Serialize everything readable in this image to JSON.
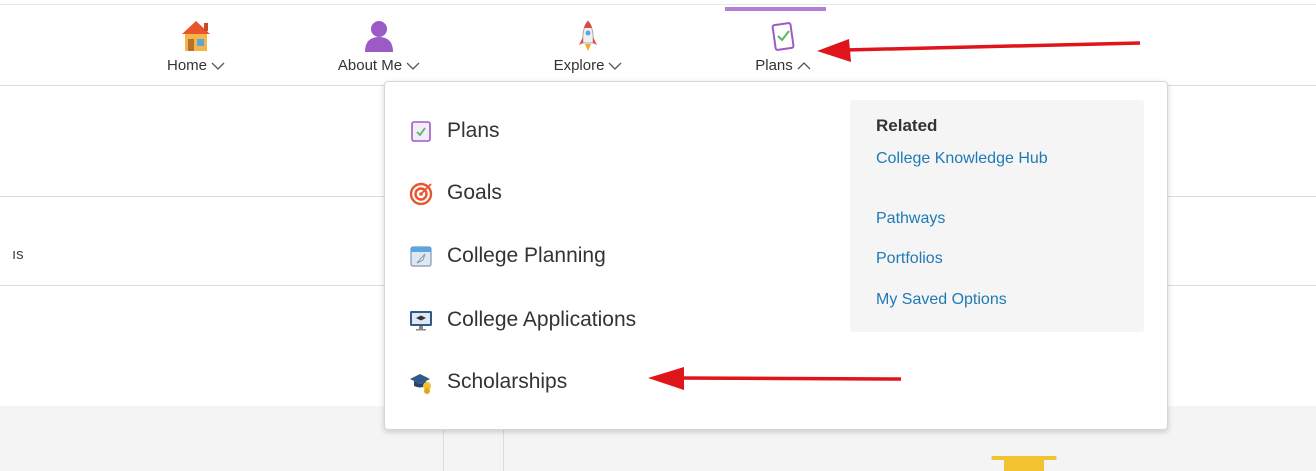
{
  "nav": {
    "items": [
      {
        "label": "Home",
        "icon": "house-icon"
      },
      {
        "label": "About Me",
        "icon": "person-icon"
      },
      {
        "label": "Explore",
        "icon": "rocket-icon"
      },
      {
        "label": "Plans",
        "icon": "clipboard-icon"
      }
    ],
    "active": "Plans",
    "accent_color": "#b27fd6"
  },
  "background": {
    "truncated_text": "ıs"
  },
  "dropdown": {
    "items": [
      {
        "label": "Plans",
        "icon": "clipboard-icon"
      },
      {
        "label": "Goals",
        "icon": "target-icon"
      },
      {
        "label": "College Planning",
        "icon": "calendar-icon"
      },
      {
        "label": "College Applications",
        "icon": "monitor-icon"
      },
      {
        "label": "Scholarships",
        "icon": "graduation-cap-icon"
      }
    ],
    "related": {
      "title": "Related",
      "links": [
        "College Knowledge Hub",
        "Pathways",
        "Portfolios",
        "My Saved Options"
      ],
      "link_color": "#1f7ab4"
    }
  },
  "annotation_color": "#e0141b"
}
